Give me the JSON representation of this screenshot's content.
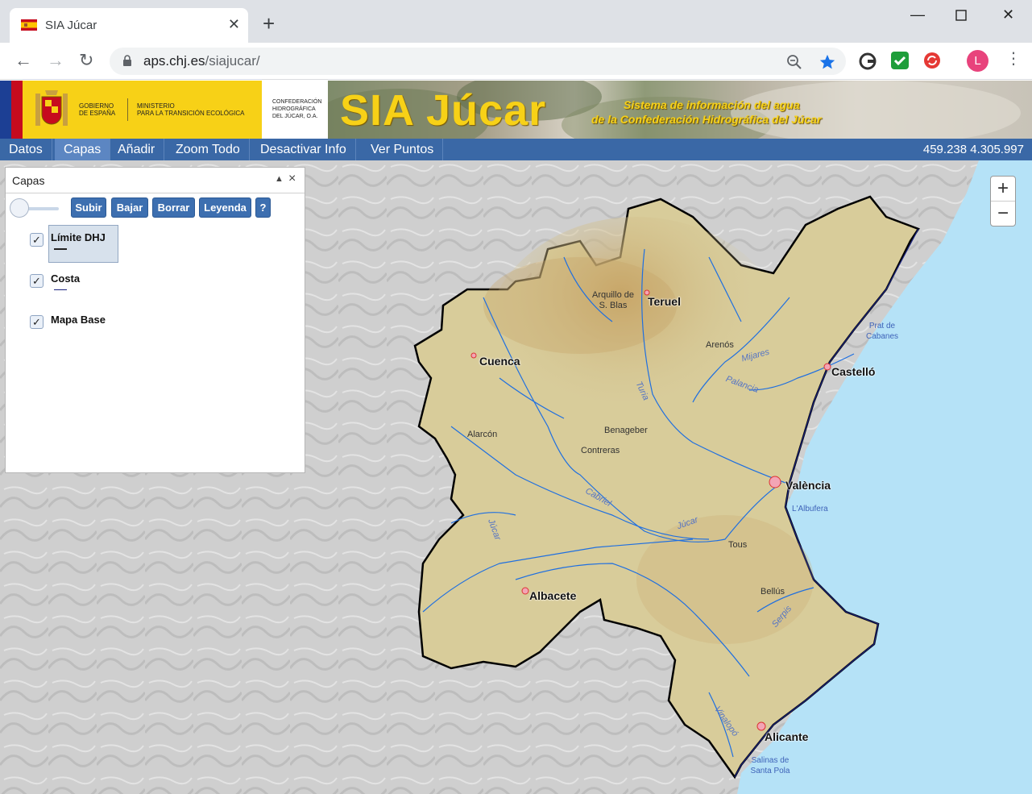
{
  "browser": {
    "tab_title": "SIA Júcar",
    "url_domain": "aps.chj.es",
    "url_path": "/siajucar/",
    "profile_initial": "L"
  },
  "banner": {
    "gov_line1": "GOBIERNO",
    "gov_line2": "DE ESPAÑA",
    "ministry_line1": "MINISTERIO",
    "ministry_line2": "PARA LA TRANSICIÓN ECOLÓGICA",
    "conf_line1": "CONFEDERACIÓN",
    "conf_line2": "HIDROGRÁFICA",
    "conf_line3": "DEL JÚCAR, O.A.",
    "title": "SIA Júcar",
    "subtitle_line1": "Sistema de información del agua",
    "subtitle_line2": "de la Confederación Hidrográfica del Júcar"
  },
  "menu": {
    "items": [
      "Datos",
      "Capas",
      "Añadir",
      "Zoom Todo",
      "Desactivar Info",
      "Ver Puntos"
    ],
    "active": "Capas",
    "coords": "459.238 4.305.997"
  },
  "zoom": {
    "in": "+",
    "out": "−"
  },
  "layers_panel": {
    "title": "Capas",
    "buttons": [
      "Subir",
      "Bajar",
      "Borrar",
      "Leyenda",
      "?"
    ],
    "opacity": 0,
    "layers": [
      {
        "name": "Límite DHJ",
        "checked": true,
        "selected": true,
        "symbol_color": "#222222"
      },
      {
        "name": "Costa",
        "checked": true,
        "selected": false,
        "symbol_color": "#1a237e"
      },
      {
        "name": "Mapa Base",
        "checked": true,
        "selected": false,
        "symbol_color": ""
      }
    ]
  },
  "map": {
    "cities": [
      "Teruel",
      "Cuenca",
      "Castelló",
      "València",
      "Albacete",
      "Alicante"
    ],
    "places": [
      "Arquillo de S. Blas",
      "Arenós",
      "Benageber",
      "Alarcón",
      "Contreras",
      "Tous",
      "Bellús"
    ],
    "rivers": [
      "Mijares",
      "Palancia",
      "Turia",
      "Cabriel",
      "Júcar",
      "Júcar",
      "Serpis",
      "Vinalopó"
    ],
    "water": [
      "Prat de Cabanes",
      "L'Albufera",
      "Salinas de Santa Pola"
    ],
    "colors": {
      "sea": "#b5e2f7",
      "basin": "#d8cc9a",
      "boundary": "#000000",
      "rivers": "#1f6fe0"
    }
  }
}
